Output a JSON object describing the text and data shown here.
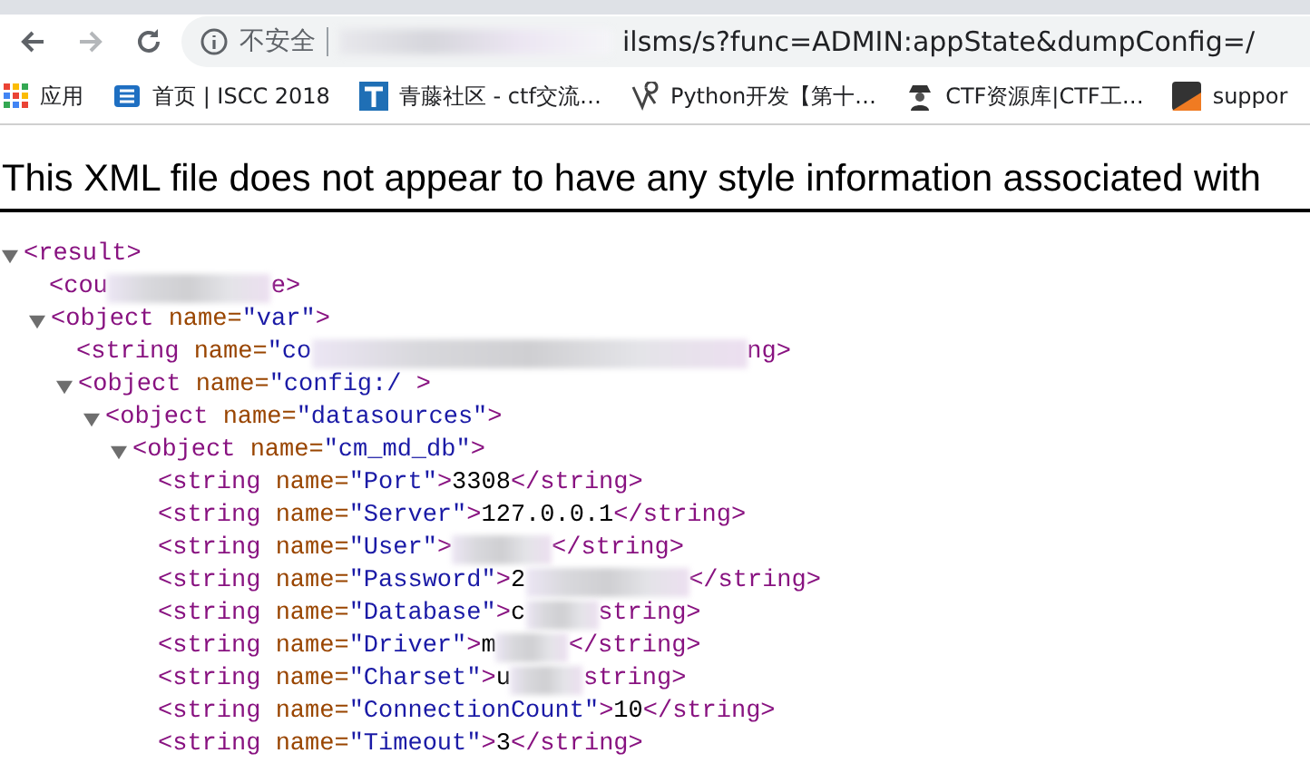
{
  "browser": {
    "nav": [
      {
        "kind": "back",
        "disabled": false
      },
      {
        "kind": "forward",
        "disabled": true
      },
      {
        "kind": "reload",
        "disabled": false
      }
    ],
    "security_label": "不安全",
    "url": "ilsms/s?func=ADMIN:appState&dumpConfig=/"
  },
  "bookmarks": [
    {
      "kind": "apps",
      "label": "应用"
    },
    {
      "kind": "iscc",
      "label": "首页 | ISCC 2018"
    },
    {
      "kind": "tsq",
      "label": "青藤社区 - ctf交流…"
    },
    {
      "kind": "python",
      "label": "Python开发【第十…"
    },
    {
      "kind": "spy",
      "label": "CTF资源库|CTF工…"
    },
    {
      "kind": "support",
      "label": "suppor"
    }
  ],
  "xml_notice": "This XML file does not appear to have any style information associated with",
  "tree": {
    "expanded": true,
    "segments": [
      {
        "kind": "tag",
        "text": "<result>"
      }
    ],
    "children": [
      {
        "segments": [
          {
            "kind": "tag",
            "text": "<cou"
          },
          {
            "kind": "blur_l"
          },
          {
            "kind": "tag",
            "text": "e>"
          }
        ]
      },
      {
        "expanded": true,
        "segments": [
          {
            "kind": "tag",
            "text": "<object"
          },
          {
            "kind": "attr",
            "text": " name="
          },
          {
            "kind": "value",
            "text": "\"var\""
          },
          {
            "kind": "tag",
            "text": ">"
          }
        ],
        "children": [
          {
            "segments": [
              {
                "kind": "tag",
                "text": "<string"
              },
              {
                "kind": "attr",
                "text": " name="
              },
              {
                "kind": "value",
                "text": "\"co"
              },
              {
                "kind": "blur_xl"
              },
              {
                "kind": "tag",
                "text": "ng>"
              }
            ]
          },
          {
            "expanded": true,
            "segments": [
              {
                "kind": "tag",
                "text": "<object"
              },
              {
                "kind": "attr",
                "text": " name="
              },
              {
                "kind": "value",
                "text": "\"config:/"
              },
              {
                "kind": "tag",
                "text": " >"
              }
            ],
            "children": [
              {
                "expanded": true,
                "segments": [
                  {
                    "kind": "tag",
                    "text": "<object"
                  },
                  {
                    "kind": "attr",
                    "text": " name="
                  },
                  {
                    "kind": "value",
                    "text": "\"datasources\""
                  },
                  {
                    "kind": "tag",
                    "text": ">"
                  }
                ],
                "children": [
                  {
                    "expanded": true,
                    "segments": [
                      {
                        "kind": "tag",
                        "text": "<object"
                      },
                      {
                        "kind": "attr",
                        "text": " name="
                      },
                      {
                        "kind": "value",
                        "text": "\"cm_md_db\""
                      },
                      {
                        "kind": "tag",
                        "text": ">"
                      }
                    ],
                    "children": [
                      {
                        "segments": [
                          {
                            "kind": "tag",
                            "text": "<string"
                          },
                          {
                            "kind": "attr",
                            "text": " name="
                          },
                          {
                            "kind": "value",
                            "text": "\"Port\""
                          },
                          {
                            "kind": "tag",
                            "text": ">"
                          },
                          {
                            "kind": "text",
                            "text": "3308"
                          },
                          {
                            "kind": "tag",
                            "text": "</string>"
                          }
                        ]
                      },
                      {
                        "segments": [
                          {
                            "kind": "tag",
                            "text": "<string"
                          },
                          {
                            "kind": "attr",
                            "text": " name="
                          },
                          {
                            "kind": "value",
                            "text": "\"Server\""
                          },
                          {
                            "kind": "tag",
                            "text": ">"
                          },
                          {
                            "kind": "text",
                            "text": "127.0.0.1"
                          },
                          {
                            "kind": "tag",
                            "text": "</string>"
                          }
                        ]
                      },
                      {
                        "segments": [
                          {
                            "kind": "tag",
                            "text": "<string"
                          },
                          {
                            "kind": "attr",
                            "text": " name="
                          },
                          {
                            "kind": "value",
                            "text": "\"User\""
                          },
                          {
                            "kind": "tag",
                            "text": ">"
                          },
                          {
                            "kind": "blur_m"
                          },
                          {
                            "kind": "tag",
                            "text": "</string>"
                          }
                        ]
                      },
                      {
                        "segments": [
                          {
                            "kind": "tag",
                            "text": "<string"
                          },
                          {
                            "kind": "attr",
                            "text": " name="
                          },
                          {
                            "kind": "value",
                            "text": "\"Password\""
                          },
                          {
                            "kind": "tag",
                            "text": ">"
                          },
                          {
                            "kind": "text",
                            "text": "2"
                          },
                          {
                            "kind": "blur_l"
                          },
                          {
                            "kind": "tag",
                            "text": "</string>"
                          }
                        ]
                      },
                      {
                        "segments": [
                          {
                            "kind": "tag",
                            "text": "<string"
                          },
                          {
                            "kind": "attr",
                            "text": " name="
                          },
                          {
                            "kind": "value",
                            "text": "\"Database\""
                          },
                          {
                            "kind": "tag",
                            "text": ">"
                          },
                          {
                            "kind": "text",
                            "text": "c"
                          },
                          {
                            "kind": "blur_s"
                          },
                          {
                            "kind": "tag",
                            "text": "string>"
                          }
                        ]
                      },
                      {
                        "segments": [
                          {
                            "kind": "tag",
                            "text": "<string"
                          },
                          {
                            "kind": "attr",
                            "text": " name="
                          },
                          {
                            "kind": "value",
                            "text": "\"Driver\""
                          },
                          {
                            "kind": "tag",
                            "text": ">"
                          },
                          {
                            "kind": "text",
                            "text": "m"
                          },
                          {
                            "kind": "blur_s"
                          },
                          {
                            "kind": "tag",
                            "text": "</string>"
                          }
                        ]
                      },
                      {
                        "segments": [
                          {
                            "kind": "tag",
                            "text": "<string"
                          },
                          {
                            "kind": "attr",
                            "text": " name="
                          },
                          {
                            "kind": "value",
                            "text": "\"Charset\""
                          },
                          {
                            "kind": "tag",
                            "text": ">"
                          },
                          {
                            "kind": "text",
                            "text": "u"
                          },
                          {
                            "kind": "blur_s"
                          },
                          {
                            "kind": "tag",
                            "text": "string>"
                          }
                        ]
                      },
                      {
                        "segments": [
                          {
                            "kind": "tag",
                            "text": "<string"
                          },
                          {
                            "kind": "attr",
                            "text": " name="
                          },
                          {
                            "kind": "value",
                            "text": "\"ConnectionCount\""
                          },
                          {
                            "kind": "tag",
                            "text": ">"
                          },
                          {
                            "kind": "text",
                            "text": "10"
                          },
                          {
                            "kind": "tag",
                            "text": "</string>"
                          }
                        ]
                      },
                      {
                        "segments": [
                          {
                            "kind": "tag",
                            "text": "<string"
                          },
                          {
                            "kind": "attr",
                            "text": " name="
                          },
                          {
                            "kind": "value",
                            "text": "\"Timeout\""
                          },
                          {
                            "kind": "tag",
                            "text": ">"
                          },
                          {
                            "kind": "text",
                            "text": "3"
                          },
                          {
                            "kind": "tag",
                            "text": "</string>"
                          }
                        ]
                      }
                    ]
                  }
                ]
              }
            ]
          }
        ]
      }
    ]
  }
}
